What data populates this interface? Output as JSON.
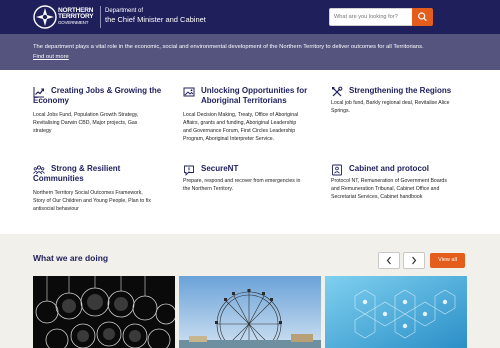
{
  "header": {
    "logo_line1": "NORTHERN",
    "logo_line2": "TERRITORY",
    "logo_line3": "GOVERNMENT",
    "dept_line1": "Department of",
    "dept_line2": "the Chief Minister and Cabinet",
    "search_placeholder": "What are you looking for?",
    "search_icon": "search-icon",
    "colors": {
      "navy": "#1f1f5c",
      "accent": "#e35d1c",
      "banner": "#54547f"
    }
  },
  "banner": {
    "text": "The department plays a vital role in the economic, social and environmental development of the Northern Territory to deliver outcomes for all Territorians.",
    "link": "Find out more"
  },
  "tiles": [
    {
      "icon": "chart-growth-icon",
      "title_line1": "Creating Jobs & Growing the",
      "title_line2": "Economy",
      "body_lines": [
        "Local Jobs Fund, Population Growth Strategy,",
        "Revitalising Darwin CBD, Major projects, Gas",
        "strategy"
      ]
    },
    {
      "icon": "image-frame-icon",
      "title_line1": "Unlocking Opportunities for",
      "title_line2": "Aboriginal Territorians",
      "body_lines": [
        "Local Decision Making, Treaty, Office of Aboriginal",
        "Affairs, grants and funding, Aboriginal Leadership",
        "and Governance Forum, First Circles Leadership",
        "Program, Aboriginal Interpreter Service."
      ]
    },
    {
      "icon": "tools-icon",
      "title_line1": "Strengthening the Regions",
      "title_line2": "",
      "body_lines": [
        "Local job fund, Barkly regional deal, Revitalise Alice",
        "Springs."
      ]
    },
    {
      "icon": "people-group-icon",
      "title_line1": "Strong & Resilient",
      "title_line2": "Communities",
      "body_lines": [
        "Northern Territory Social Outcomes Framework,",
        "Story of Our Children and Young People, Plan to fix",
        "antisocial behaviour"
      ]
    },
    {
      "icon": "alert-speech-icon",
      "title_line1": "SecureNT",
      "title_line2": "",
      "body_lines": [
        "Prepare, respond and recover from emergencies in",
        "the Northern Territory."
      ]
    },
    {
      "icon": "id-card-icon",
      "title_line1": "Cabinet and protocol",
      "title_line2": "",
      "body_lines": [
        "Protocol NT, Remuneration of Government Boards",
        "and Remuneration Tribunal, Cabinet Office and",
        "Secretariat Services, Cabinet handbook"
      ]
    }
  ],
  "doing": {
    "title": "What we are doing",
    "prev_icon": "chevron-left-icon",
    "next_icon": "chevron-right-icon",
    "view_all": "View all",
    "cards": [
      {
        "image": "lightbulbs-photo"
      },
      {
        "image": "ferris-wheel-photo"
      },
      {
        "image": "hexagon-network-photo"
      }
    ]
  }
}
